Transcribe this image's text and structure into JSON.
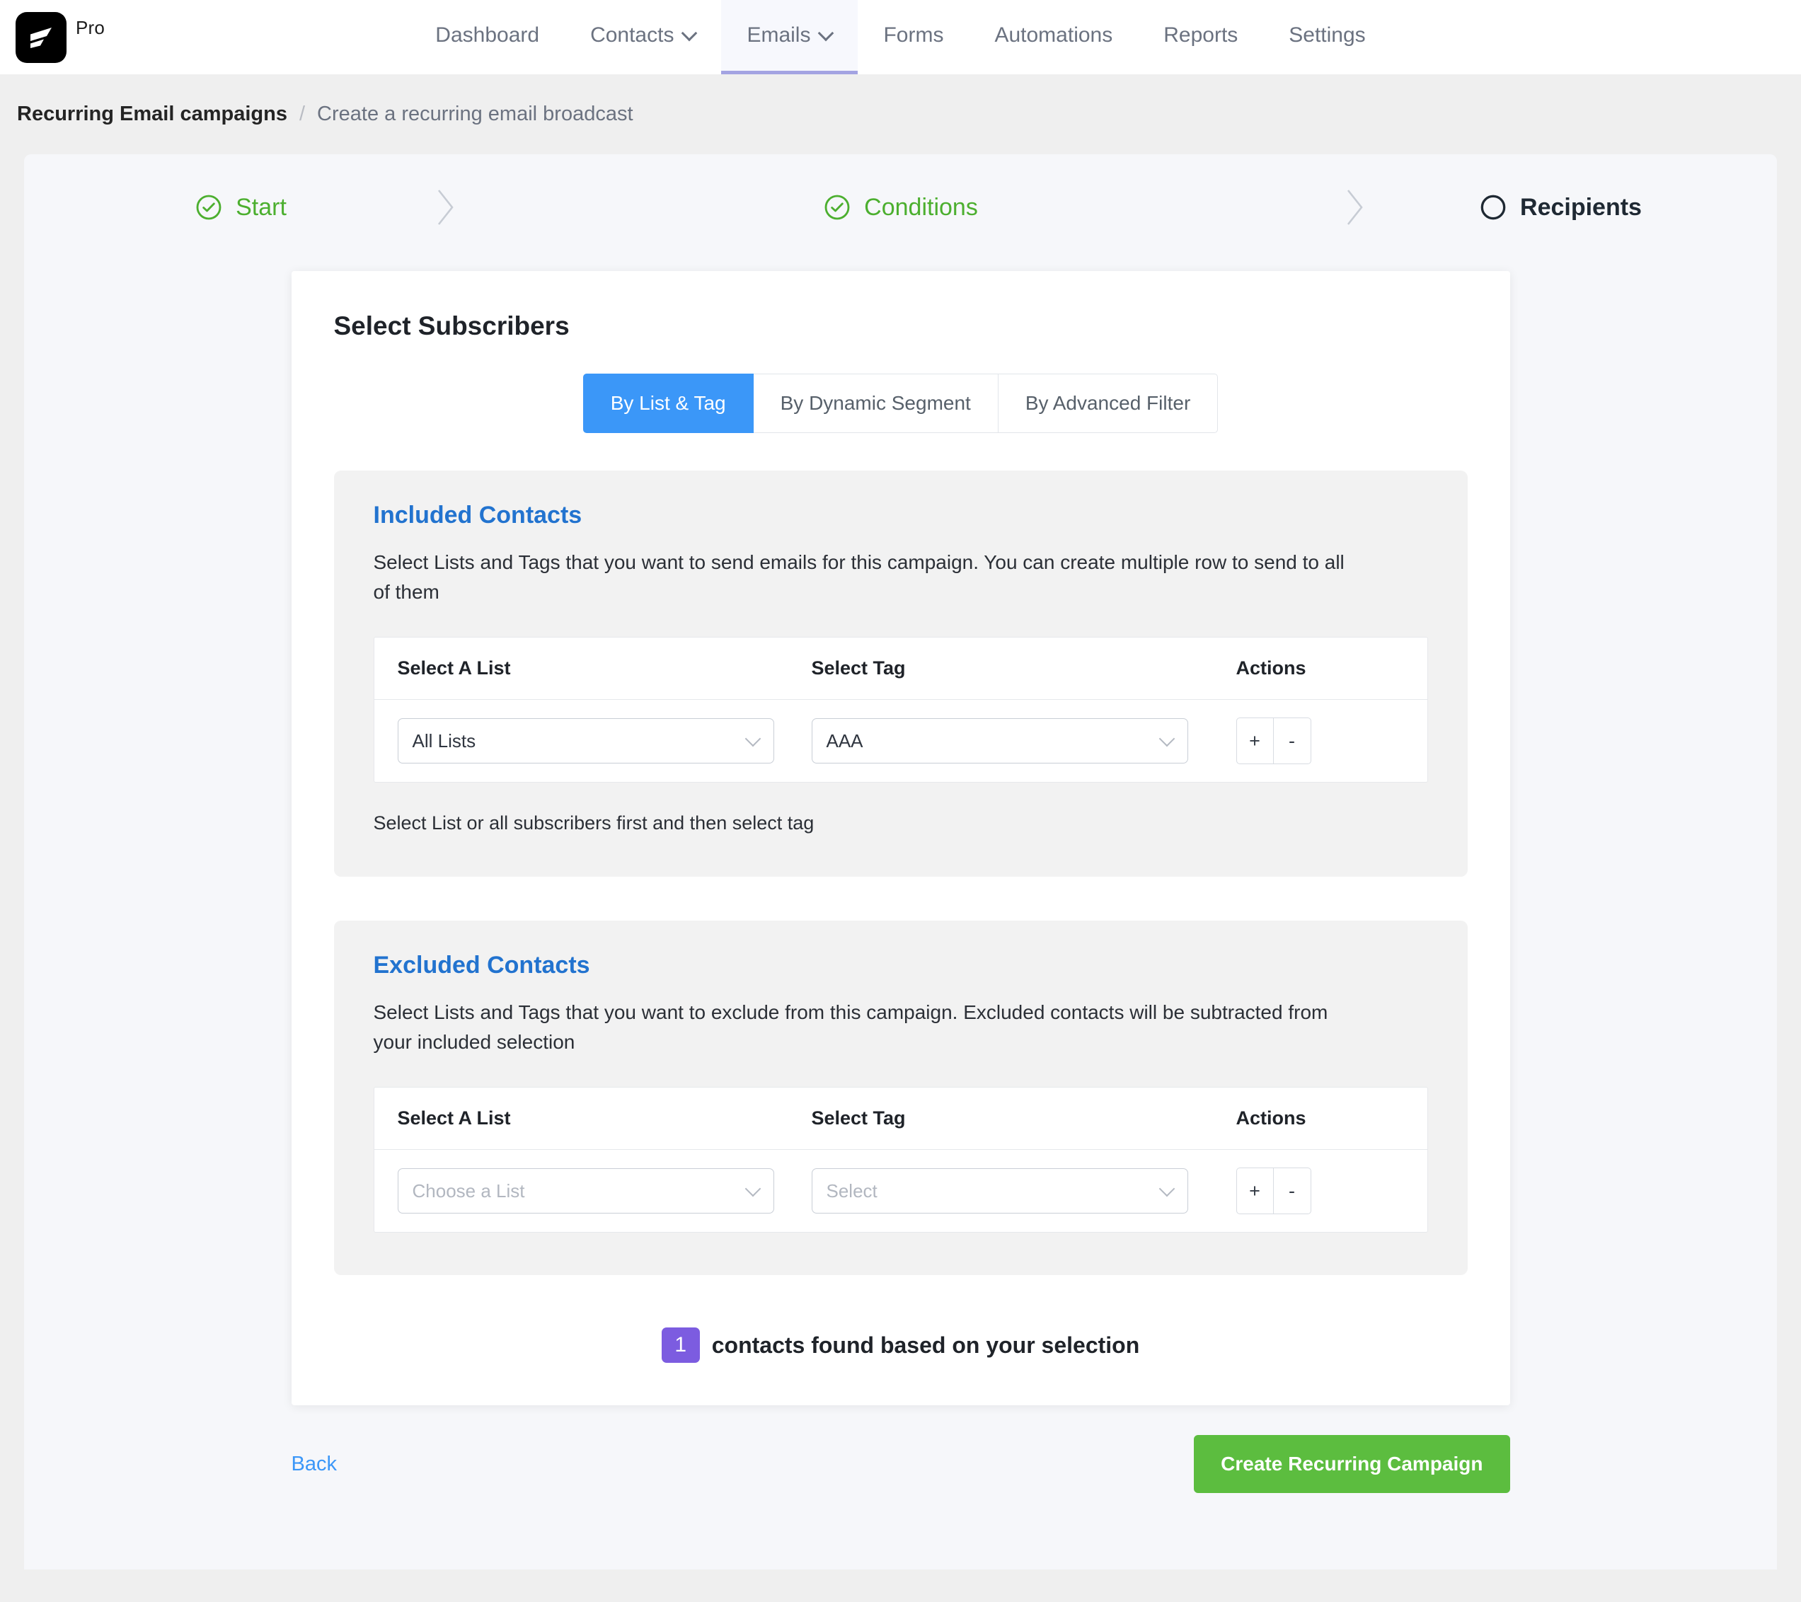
{
  "brand": {
    "logo_icon": "fluent-crm-logo-icon",
    "tier_label": "Pro"
  },
  "nav": {
    "items": [
      {
        "label": "Dashboard",
        "has_caret": false,
        "active": false
      },
      {
        "label": "Contacts",
        "has_caret": true,
        "active": false
      },
      {
        "label": "Emails",
        "has_caret": true,
        "active": true
      },
      {
        "label": "Forms",
        "has_caret": false,
        "active": false
      },
      {
        "label": "Automations",
        "has_caret": false,
        "active": false
      },
      {
        "label": "Reports",
        "has_caret": false,
        "active": false
      },
      {
        "label": "Settings",
        "has_caret": false,
        "active": false
      }
    ]
  },
  "breadcrumb": {
    "root": "Recurring Email campaigns",
    "separator": "/",
    "current": "Create a recurring email broadcast"
  },
  "stepper": {
    "steps": [
      {
        "label": "Start",
        "state": "done",
        "icon": "check-circle-icon"
      },
      {
        "label": "Conditions",
        "state": "done",
        "icon": "check-circle-icon"
      },
      {
        "label": "Recipients",
        "state": "active",
        "icon": "empty-circle-icon"
      }
    ],
    "separator_icon": "chevron-right-icon",
    "done_color": "#4caf2f",
    "active_color": "#1f2933"
  },
  "card": {
    "title": "Select Subscribers",
    "tabs": [
      {
        "label": "By List & Tag",
        "active": true
      },
      {
        "label": "By Dynamic Segment",
        "active": false
      },
      {
        "label": "By Advanced Filter",
        "active": false
      }
    ],
    "active_tab_color": "#3b97f8"
  },
  "included": {
    "title": "Included Contacts",
    "description": "Select Lists and Tags that you want to send emails for this campaign. You can create multiple row to send to all of them",
    "columns": {
      "list": "Select A List",
      "tag": "Select Tag",
      "actions": "Actions"
    },
    "row": {
      "list_value": "All Lists",
      "list_placeholder": "Choose a List",
      "tag_value": "AAA",
      "tag_placeholder": "Select",
      "add_label": "+",
      "remove_label": "-"
    },
    "hint": "Select List or all subscribers first and then select tag"
  },
  "excluded": {
    "title": "Excluded Contacts",
    "description": "Select Lists and Tags that you want to exclude from this campaign. Excluded contacts will be subtracted from your included selection",
    "columns": {
      "list": "Select A List",
      "tag": "Select Tag",
      "actions": "Actions"
    },
    "row": {
      "list_value": "",
      "list_placeholder": "Choose a List",
      "tag_value": "",
      "tag_placeholder": "Select",
      "add_label": "+",
      "remove_label": "-"
    }
  },
  "summary": {
    "count": "1",
    "text": "contacts found based on your selection",
    "badge_color": "#7c5ce0"
  },
  "footer": {
    "back_label": "Back",
    "submit_label": "Create Recurring Campaign",
    "submit_color": "#5cbd3f"
  }
}
